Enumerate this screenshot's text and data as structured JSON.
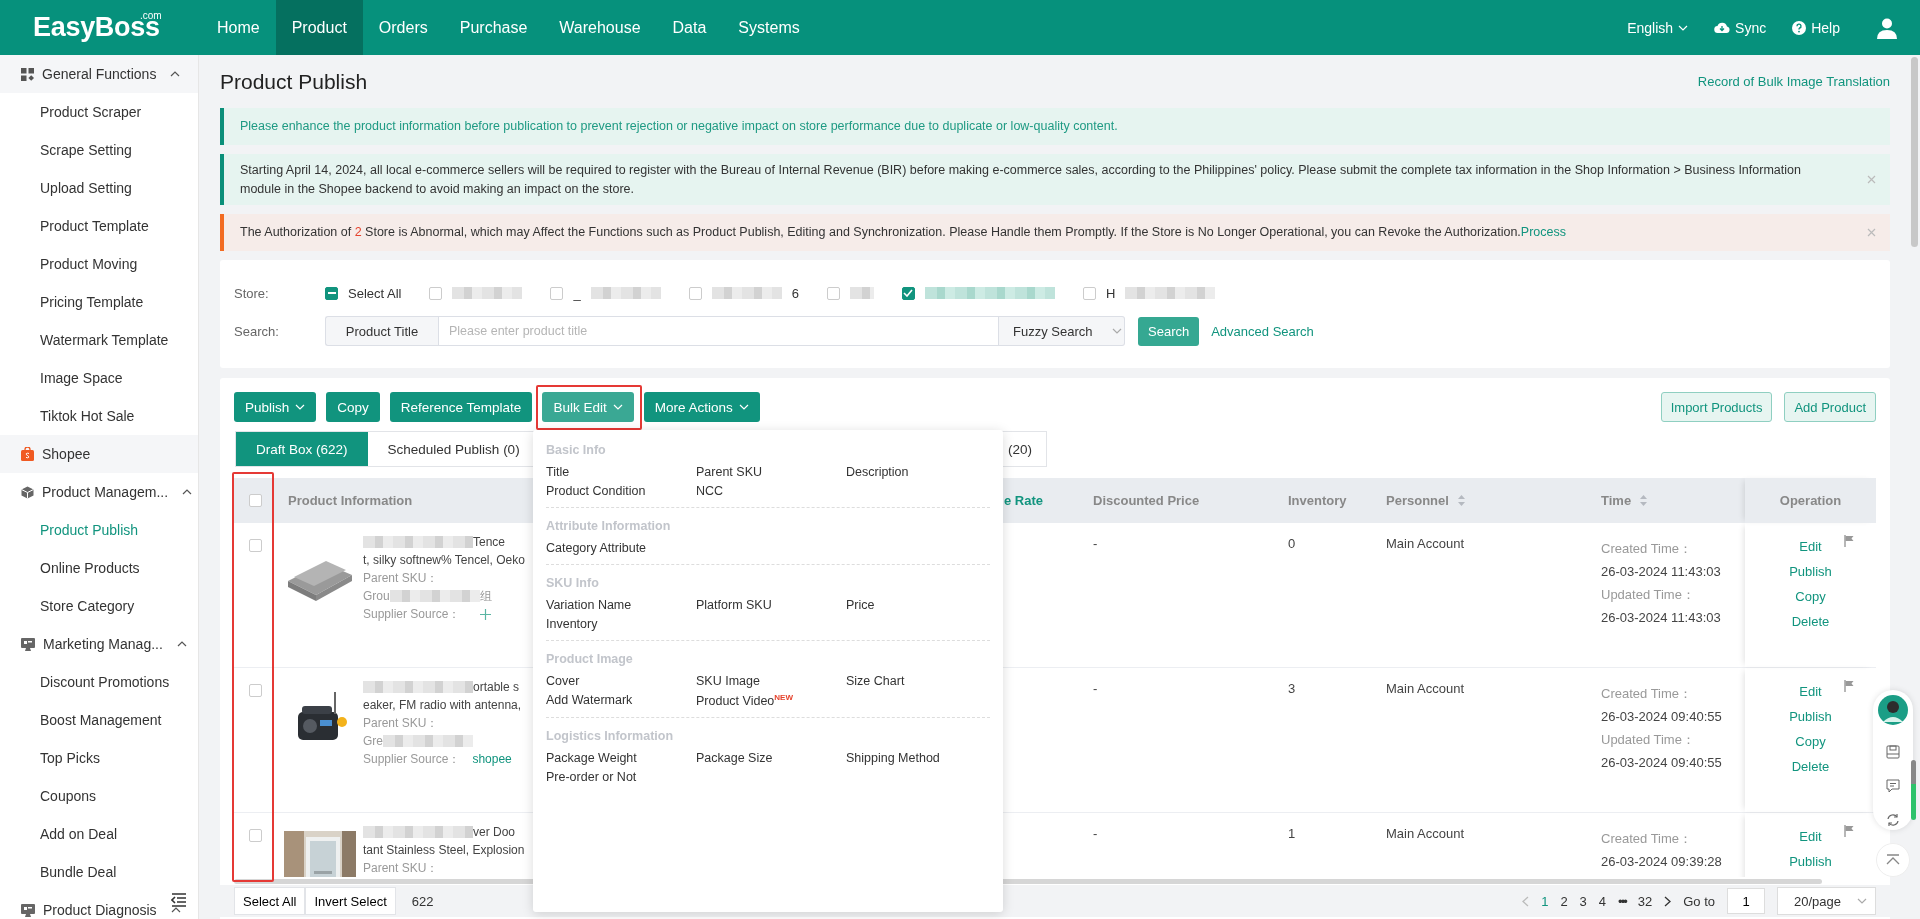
{
  "nav": {
    "logo": "EasyBoss",
    "logo_suffix": ".com",
    "items": [
      {
        "label": "Home",
        "selected": false
      },
      {
        "label": "Product",
        "selected": true
      },
      {
        "label": "Orders",
        "selected": false
      },
      {
        "label": "Purchase",
        "selected": false
      },
      {
        "label": "Warehouse",
        "selected": false
      },
      {
        "label": "Data",
        "selected": false
      },
      {
        "label": "Systems",
        "selected": false
      }
    ],
    "language": "English",
    "sync": "Sync",
    "help": "Help"
  },
  "sidebar": [
    {
      "label": "General Functions",
      "expanded": true,
      "children": [
        {
          "label": "Product Scraper",
          "selected": false
        },
        {
          "label": "Scrape Setting",
          "selected": false
        },
        {
          "label": "Upload Setting",
          "selected": false
        },
        {
          "label": "Product Template",
          "selected": false
        },
        {
          "label": "Product Moving",
          "selected": false
        },
        {
          "label": "Pricing Template",
          "selected": false
        },
        {
          "label": "Watermark Template",
          "selected": false
        },
        {
          "label": "Image Space",
          "selected": false
        },
        {
          "label": "Tiktok Hot Sale",
          "selected": false
        }
      ]
    },
    {
      "label": "Shopee",
      "children": [
        {
          "label": "Product Managem...",
          "expanded": true,
          "children": [
            {
              "label": "Product Publish",
              "selected": true
            },
            {
              "label": "Online Products",
              "selected": false
            },
            {
              "label": "Store Category",
              "selected": false
            }
          ]
        },
        {
          "label": "Marketing Manag...",
          "expanded": true,
          "children": [
            {
              "label": "Discount Promotions",
              "selected": false
            },
            {
              "label": "Boost Management",
              "selected": false
            },
            {
              "label": "Top Picks",
              "selected": false
            },
            {
              "label": "Coupons",
              "selected": false
            },
            {
              "label": "Add on Deal",
              "selected": false
            },
            {
              "label": "Bundle Deal",
              "selected": false
            }
          ]
        },
        {
          "label": "Product Diagnosis",
          "expanded": true
        }
      ]
    }
  ],
  "page_title": "Product Publish",
  "record_link": "Record of Bulk Image Translation",
  "alerts": [
    {
      "kind": "info",
      "text": "Please enhance the product information before publication to prevent rejection or negative impact on store performance due to duplicate or low-quality content."
    },
    {
      "kind": "notice",
      "closable": true,
      "text": "Starting April 14, 2024, all local e-commerce sellers will be required to register with the Bureau of Internal Revenue (BIR) before making e-commerce sales, according to the Philippines' policy. Please submit the complete tax information in the Shop Information > Business Information module in the Shopee backend to avoid making an impact on the store."
    },
    {
      "kind": "warning",
      "closable": true,
      "text": "The Authorization of ",
      "count": "2",
      "text_after": " Store is Abnormal, which may Affect the Functions such as Product Publish, Editing and Synchronization. Please Handle them Promptly. If the Store is No Longer Operational, you can Revoke the Authorization.",
      "link": "Process"
    }
  ],
  "filters": {
    "store_label": "Store:",
    "select_all": {
      "label": "Select All",
      "indeterminate": true
    },
    "stores": [
      {
        "checked": false
      },
      {
        "checked": false,
        "prefix": "_"
      },
      {
        "checked": false,
        "suffix": "6"
      },
      {
        "checked": false
      },
      {
        "checked": true
      },
      {
        "checked": false,
        "prefix": "H"
      }
    ],
    "search_label": "Search:",
    "field": "Product Title",
    "placeholder": "Please enter product title",
    "mode": "Fuzzy Search",
    "search_button": "Search",
    "advanced": "Advanced Search"
  },
  "toolbar": {
    "buttons": [
      {
        "label": "Publish",
        "dropdown": true,
        "active": false
      },
      {
        "label": "Copy",
        "active": false
      },
      {
        "label": "Reference Template",
        "active": false
      },
      {
        "label": "Bulk Edit",
        "dropdown": true,
        "active": true
      },
      {
        "label": "More Actions",
        "dropdown": true,
        "active": false
      }
    ],
    "right_buttons": [
      "Import Products",
      "Add Product"
    ]
  },
  "bulk_edit_menu": [
    {
      "title": "Basic Info",
      "items": [
        {
          "label": "Title"
        },
        {
          "label": "Parent SKU"
        },
        {
          "label": "Description"
        },
        {
          "label": "Product Condition"
        },
        {
          "label": "NCC"
        }
      ]
    },
    {
      "title": "Attribute Information",
      "items": [
        {
          "label": "Category Attribute"
        }
      ]
    },
    {
      "title": "SKU Info",
      "items": [
        {
          "label": "Variation Name"
        },
        {
          "label": "Platform SKU"
        },
        {
          "label": "Price"
        },
        {
          "label": "Inventory"
        }
      ]
    },
    {
      "title": "Product Image",
      "items": [
        {
          "label": "Cover"
        },
        {
          "label": "SKU Image"
        },
        {
          "label": "Size Chart"
        },
        {
          "label": "Add Watermark"
        },
        {
          "label": "Product Video",
          "badge": "NEW"
        }
      ]
    },
    {
      "title": "Logistics Information",
      "items": [
        {
          "label": "Package Weight"
        },
        {
          "label": "Package Size"
        },
        {
          "label": "Shipping Method"
        },
        {
          "label": "Pre-order or Not"
        }
      ]
    }
  ],
  "tabs": [
    {
      "label": "Draft Box (622)",
      "selected": true
    },
    {
      "label": "Scheduled Publish (0)",
      "selected": false
    },
    {
      "label": "(20)",
      "selected": false
    }
  ],
  "table": {
    "columns": [
      {
        "label": "Product Information",
        "active": false
      },
      {
        "label": "e Rate",
        "active": true
      },
      {
        "label": "Discounted Price",
        "active": false
      },
      {
        "label": "Inventory",
        "active": false
      },
      {
        "label": "Personnel",
        "active": false,
        "sortable": true
      },
      {
        "label": "Time",
        "active": false,
        "sortable": true
      },
      {
        "label": "Operation",
        "active": false
      }
    ],
    "select_all_checked": false,
    "rows": [
      {
        "checked": false,
        "title_lines": [
          "Tence",
          "t, silky softnew% Tencel, Oeko"
        ],
        "details": [
          {
            "kind": "text",
            "label": "Parent SKU："
          },
          {
            "kind": "group",
            "label": "Grou",
            "tail": "组"
          },
          {
            "kind": "source",
            "label": "Supplier Source："
          }
        ],
        "discounted": "-",
        "inventory": "0",
        "personnel": "Main Account",
        "times": [
          {
            "label": "Created Time：",
            "value": "26-03-2024 11:43:03"
          },
          {
            "label": "Updated Time：",
            "value": "26-03-2024 11:43:03"
          }
        ],
        "operations": [
          "Edit",
          "Publish",
          "Copy",
          "Delete"
        ]
      },
      {
        "checked": false,
        "title_lines": [
          "ortable s",
          "eaker, FM radio with antenna,"
        ],
        "details": [
          {
            "kind": "text",
            "label": "Parent SKU："
          },
          {
            "kind": "group",
            "label": "Gre"
          },
          {
            "kind": "source",
            "label": "Supplier Source：",
            "link": "shopee"
          }
        ],
        "discounted": "-",
        "inventory": "3",
        "personnel": "Main Account",
        "times": [
          {
            "label": "Created Time：",
            "value": "26-03-2024 09:40:55"
          },
          {
            "label": "Updated Time：",
            "value": "26-03-2024 09:40:55"
          }
        ],
        "operations": [
          "Edit",
          "Publish",
          "Copy",
          "Delete"
        ]
      },
      {
        "checked": false,
        "title_lines": [
          "ver Doo",
          "tant Stainless Steel, Explosion"
        ],
        "details": [
          {
            "kind": "text",
            "label": "Parent SKU："
          }
        ],
        "discounted": "-",
        "inventory": "1",
        "personnel": "Main Account",
        "times": [
          {
            "label": "Created Time：",
            "value": "26-03-2024 09:39:28"
          }
        ],
        "operations": [
          "Edit",
          "Publish"
        ]
      }
    ]
  },
  "footer": {
    "select_all": "Select All",
    "invert": "Invert Select",
    "total": "622",
    "pages": [
      {
        "label": "1",
        "selected": true
      },
      {
        "label": "2",
        "selected": false
      },
      {
        "label": "3",
        "selected": false
      },
      {
        "label": "4",
        "selected": false
      },
      {
        "label": "32",
        "selected": false
      }
    ],
    "ellipsis": "•••",
    "goto": "Go to",
    "goto_value": "1",
    "page_size": "20/page"
  }
}
